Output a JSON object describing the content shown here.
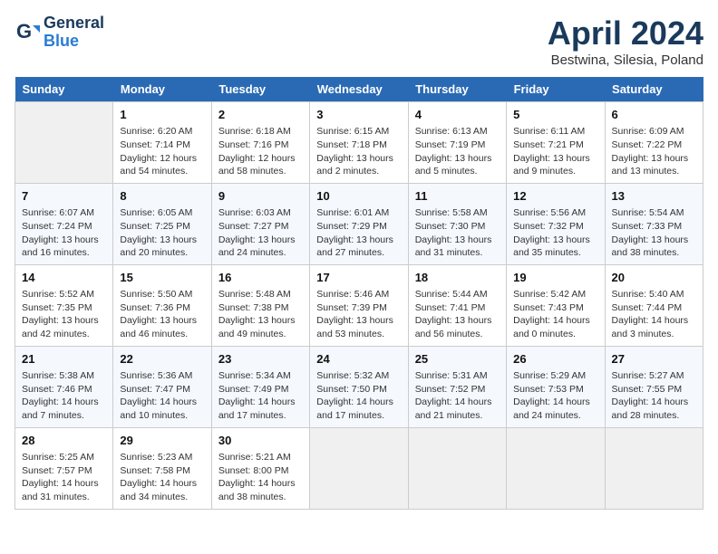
{
  "header": {
    "logo_line1": "General",
    "logo_line2": "Blue",
    "month": "April 2024",
    "location": "Bestwina, Silesia, Poland"
  },
  "weekdays": [
    "Sunday",
    "Monday",
    "Tuesday",
    "Wednesday",
    "Thursday",
    "Friday",
    "Saturday"
  ],
  "weeks": [
    [
      {
        "day": "",
        "empty": true
      },
      {
        "day": "1",
        "sunrise": "6:20 AM",
        "sunset": "7:14 PM",
        "daylight": "12 hours and 54 minutes."
      },
      {
        "day": "2",
        "sunrise": "6:18 AM",
        "sunset": "7:16 PM",
        "daylight": "12 hours and 58 minutes."
      },
      {
        "day": "3",
        "sunrise": "6:15 AM",
        "sunset": "7:18 PM",
        "daylight": "13 hours and 2 minutes."
      },
      {
        "day": "4",
        "sunrise": "6:13 AM",
        "sunset": "7:19 PM",
        "daylight": "13 hours and 5 minutes."
      },
      {
        "day": "5",
        "sunrise": "6:11 AM",
        "sunset": "7:21 PM",
        "daylight": "13 hours and 9 minutes."
      },
      {
        "day": "6",
        "sunrise": "6:09 AM",
        "sunset": "7:22 PM",
        "daylight": "13 hours and 13 minutes."
      }
    ],
    [
      {
        "day": "7",
        "sunrise": "6:07 AM",
        "sunset": "7:24 PM",
        "daylight": "13 hours and 16 minutes."
      },
      {
        "day": "8",
        "sunrise": "6:05 AM",
        "sunset": "7:25 PM",
        "daylight": "13 hours and 20 minutes."
      },
      {
        "day": "9",
        "sunrise": "6:03 AM",
        "sunset": "7:27 PM",
        "daylight": "13 hours and 24 minutes."
      },
      {
        "day": "10",
        "sunrise": "6:01 AM",
        "sunset": "7:29 PM",
        "daylight": "13 hours and 27 minutes."
      },
      {
        "day": "11",
        "sunrise": "5:58 AM",
        "sunset": "7:30 PM",
        "daylight": "13 hours and 31 minutes."
      },
      {
        "day": "12",
        "sunrise": "5:56 AM",
        "sunset": "7:32 PM",
        "daylight": "13 hours and 35 minutes."
      },
      {
        "day": "13",
        "sunrise": "5:54 AM",
        "sunset": "7:33 PM",
        "daylight": "13 hours and 38 minutes."
      }
    ],
    [
      {
        "day": "14",
        "sunrise": "5:52 AM",
        "sunset": "7:35 PM",
        "daylight": "13 hours and 42 minutes."
      },
      {
        "day": "15",
        "sunrise": "5:50 AM",
        "sunset": "7:36 PM",
        "daylight": "13 hours and 46 minutes."
      },
      {
        "day": "16",
        "sunrise": "5:48 AM",
        "sunset": "7:38 PM",
        "daylight": "13 hours and 49 minutes."
      },
      {
        "day": "17",
        "sunrise": "5:46 AM",
        "sunset": "7:39 PM",
        "daylight": "13 hours and 53 minutes."
      },
      {
        "day": "18",
        "sunrise": "5:44 AM",
        "sunset": "7:41 PM",
        "daylight": "13 hours and 56 minutes."
      },
      {
        "day": "19",
        "sunrise": "5:42 AM",
        "sunset": "7:43 PM",
        "daylight": "14 hours and 0 minutes."
      },
      {
        "day": "20",
        "sunrise": "5:40 AM",
        "sunset": "7:44 PM",
        "daylight": "14 hours and 3 minutes."
      }
    ],
    [
      {
        "day": "21",
        "sunrise": "5:38 AM",
        "sunset": "7:46 PM",
        "daylight": "14 hours and 7 minutes."
      },
      {
        "day": "22",
        "sunrise": "5:36 AM",
        "sunset": "7:47 PM",
        "daylight": "14 hours and 10 minutes."
      },
      {
        "day": "23",
        "sunrise": "5:34 AM",
        "sunset": "7:49 PM",
        "daylight": "14 hours and 17 minutes."
      },
      {
        "day": "24",
        "sunrise": "5:32 AM",
        "sunset": "7:50 PM",
        "daylight": "14 hours and 17 minutes."
      },
      {
        "day": "25",
        "sunrise": "5:31 AM",
        "sunset": "7:52 PM",
        "daylight": "14 hours and 21 minutes."
      },
      {
        "day": "26",
        "sunrise": "5:29 AM",
        "sunset": "7:53 PM",
        "daylight": "14 hours and 24 minutes."
      },
      {
        "day": "27",
        "sunrise": "5:27 AM",
        "sunset": "7:55 PM",
        "daylight": "14 hours and 28 minutes."
      }
    ],
    [
      {
        "day": "28",
        "sunrise": "5:25 AM",
        "sunset": "7:57 PM",
        "daylight": "14 hours and 31 minutes."
      },
      {
        "day": "29",
        "sunrise": "5:23 AM",
        "sunset": "7:58 PM",
        "daylight": "14 hours and 34 minutes."
      },
      {
        "day": "30",
        "sunrise": "5:21 AM",
        "sunset": "8:00 PM",
        "daylight": "14 hours and 38 minutes."
      },
      {
        "day": "",
        "empty": true
      },
      {
        "day": "",
        "empty": true
      },
      {
        "day": "",
        "empty": true
      },
      {
        "day": "",
        "empty": true
      }
    ]
  ]
}
